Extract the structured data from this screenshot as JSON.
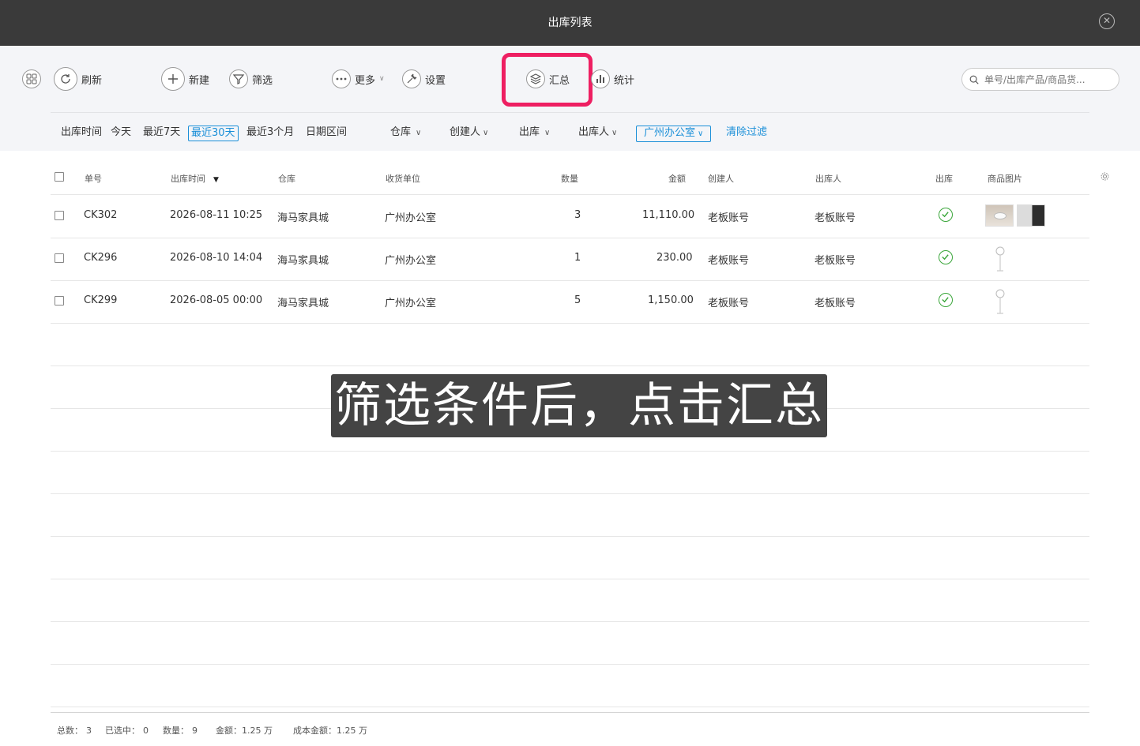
{
  "window": {
    "title": "出库列表"
  },
  "toolbar": {
    "refresh": "刷新",
    "new": "新建",
    "filter": "筛选",
    "more": "更多",
    "settings": "设置",
    "summary": "汇总",
    "stats": "统计",
    "search_placeholder": "单号/出库产品/商品货..."
  },
  "filters": {
    "time_label": "出库时间",
    "today": "今天",
    "last7": "最近7天",
    "last30": "最近30天",
    "last3m": "最近3个月",
    "range": "日期区间",
    "warehouse": "仓库",
    "creator": "创建人",
    "outbound": "出库",
    "outbound_person": "出库人",
    "receiver_tag": "广州办公室",
    "clear": "清除过滤"
  },
  "table": {
    "columns": {
      "id": "单号",
      "time": "出库时间",
      "warehouse": "仓库",
      "receiver": "收货单位",
      "qty": "数量",
      "amount": "金额",
      "creator": "创建人",
      "out_person": "出库人",
      "outbound": "出库",
      "image": "商品图片"
    },
    "rows": [
      {
        "id": "CK302",
        "time": "2026-08-11 10:25",
        "warehouse": "海马家具城",
        "receiver": "广州办公室",
        "qty": "3",
        "amount": "11,110.00",
        "creator": "老板账号",
        "out_person": "老板账号"
      },
      {
        "id": "CK296",
        "time": "2026-08-10 14:04",
        "warehouse": "海马家具城",
        "receiver": "广州办公室",
        "qty": "1",
        "amount": "230.00",
        "creator": "老板账号",
        "out_person": "老板账号"
      },
      {
        "id": "CK299",
        "time": "2026-08-05 00:00",
        "warehouse": "海马家具城",
        "receiver": "广州办公室",
        "qty": "5",
        "amount": "1,150.00",
        "creator": "老板账号",
        "out_person": "老板账号"
      }
    ]
  },
  "overlay": {
    "caption": "筛选条件后，点击汇总"
  },
  "footer": {
    "total_label": "总数：",
    "total": "3",
    "selected_label": "已选中：",
    "selected": "0",
    "qty_label": "数量：",
    "qty": "9",
    "amount_label": "金额：",
    "amount": "1.25 万",
    "cost_label": "成本金额：",
    "cost": "1.25 万"
  },
  "colors": {
    "highlight": "#ee1f62",
    "accent": "#1a8fd8",
    "titlebar": "#3a3a3a",
    "check": "#3aa63a"
  }
}
